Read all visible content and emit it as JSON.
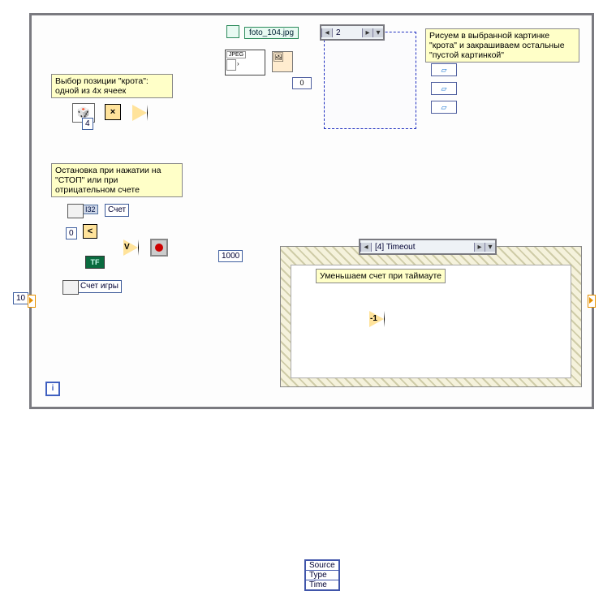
{
  "comments": {
    "mole_pos": "Выбор позиции \"крота\": одной из 4х ячеек",
    "stop_cond": "Остановка при нажатии на \"СТОП\" или при отрицательном счете",
    "draw_mole": "Рисуем в выбранной картинке \"крота\" и закрашиваем остальные \"пустой картинкой\"",
    "timeout_dec": "Уменьшаем счет при таймауте"
  },
  "labels": {
    "count_ind": "Счет",
    "count_loc": "Счет игры"
  },
  "constants": {
    "initial": "10",
    "four": "4",
    "zero": "0",
    "zero_img": "0",
    "timeout_ms": "1000",
    "tf": "TF",
    "i32": "I32",
    "jpeg": "JPEG",
    "decrement": "-1"
  },
  "file_path": "foto_104.jpg",
  "case_ring": "2",
  "event_ring": "[4] Timeout",
  "event_data_nodes": [
    "Source",
    "Type",
    "Time"
  ]
}
